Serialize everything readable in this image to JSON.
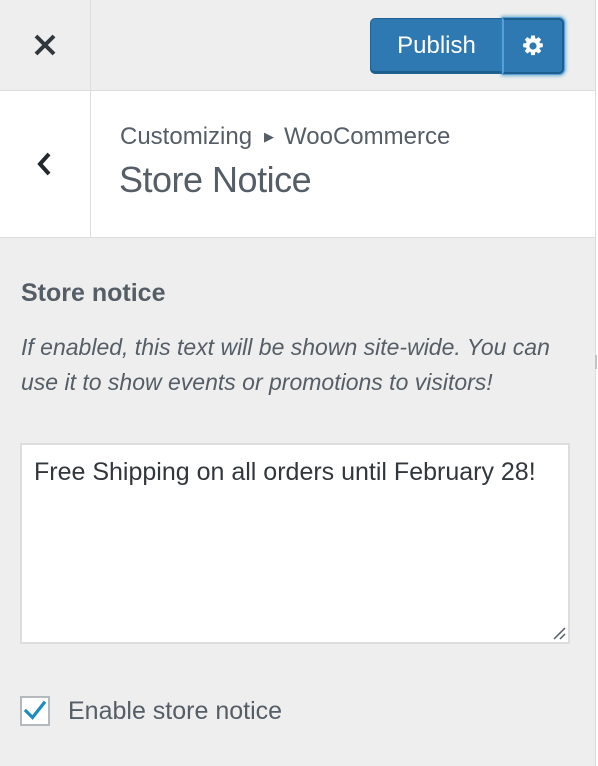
{
  "header": {
    "close_icon": "close-icon",
    "publish_label": "Publish",
    "settings_icon": "gear-icon",
    "accent_color": "#2f79b3"
  },
  "section": {
    "back_icon": "chevron-left-icon",
    "breadcrumb": {
      "root": "Customizing",
      "separator_icon": "caret-right-icon",
      "current": "WooCommerce"
    },
    "title": "Store Notice"
  },
  "control": {
    "title": "Store notice",
    "description": "If enabled, this text will be shown site-wide. You can use it to show events or promotions to visitors!",
    "textarea_value": "Free Shipping on all orders until February 28!",
    "checkbox_label": "Enable store notice",
    "checkbox_checked": true,
    "check_color": "#1e8cbe"
  }
}
